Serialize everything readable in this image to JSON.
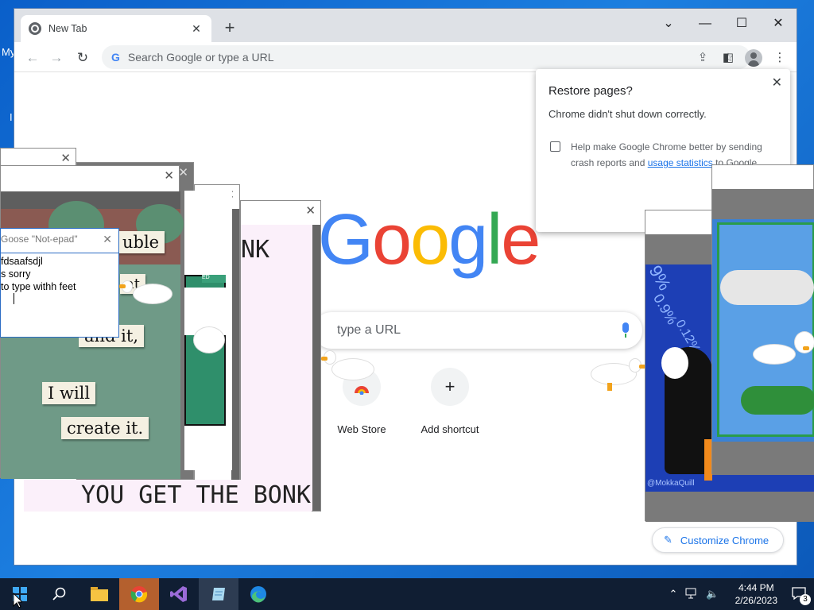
{
  "desktop": {
    "label1": "My",
    "label2": "I"
  },
  "tab": {
    "title": "New Tab"
  },
  "toolbar": {
    "omnibox_placeholder": "Search Google or type a URL"
  },
  "ntp": {
    "search_text": "type a URL",
    "shortcuts": [
      {
        "label": "Web Store"
      },
      {
        "label": "Add shortcut",
        "symbol": "+"
      }
    ],
    "customize_label": "Customize Chrome"
  },
  "restore": {
    "title": "Restore pages?",
    "message": "Chrome didn't shut down correctly.",
    "help_prefix": "Help make Google Chrome better by sending crash reports and ",
    "help_link": "usage statistics",
    "help_suffix": " to Google"
  },
  "notepad": {
    "title": "Goose \"Not-epad\"",
    "lines": [
      "fdsaafsdjl",
      "s      sorry",
      "to type withh feet"
    ]
  },
  "meme_notes": [
    "uble",
    "at",
    "and it,",
    "I will",
    "create it."
  ],
  "meme2": {
    "top_text": "NK",
    "bottom_text": "YOU GET THE BONK"
  },
  "meme3": {
    "badge": "ED"
  },
  "stocks": {
    "values": [
      "9%",
      "0.9%",
      "0.12%"
    ],
    "watermark": "@MokkaQuill"
  },
  "taskbar": {
    "time": "4:44 PM",
    "date": "2/26/2023",
    "notification_count": "3"
  }
}
